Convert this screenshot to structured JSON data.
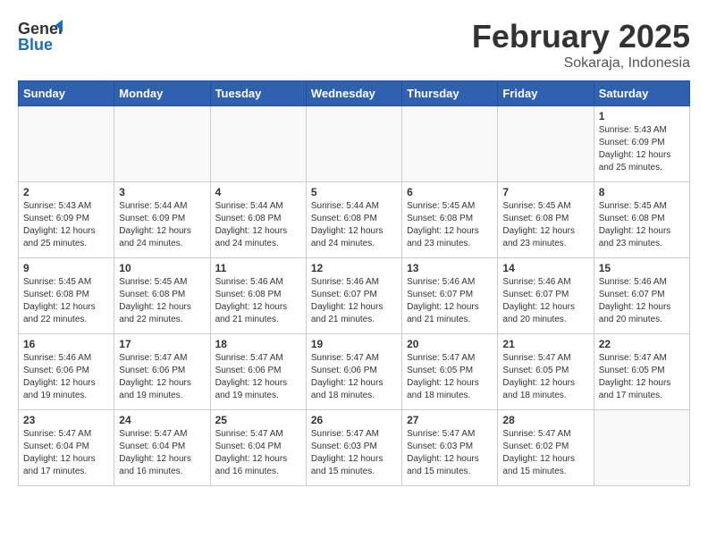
{
  "header": {
    "logo_general": "General",
    "logo_blue": "Blue",
    "month_title": "February 2025",
    "location": "Sokaraja, Indonesia"
  },
  "weekdays": [
    "Sunday",
    "Monday",
    "Tuesday",
    "Wednesday",
    "Thursday",
    "Friday",
    "Saturday"
  ],
  "weeks": [
    [
      {
        "day": "",
        "info": ""
      },
      {
        "day": "",
        "info": ""
      },
      {
        "day": "",
        "info": ""
      },
      {
        "day": "",
        "info": ""
      },
      {
        "day": "",
        "info": ""
      },
      {
        "day": "",
        "info": ""
      },
      {
        "day": "1",
        "info": "Sunrise: 5:43 AM\nSunset: 6:09 PM\nDaylight: 12 hours\nand 25 minutes."
      }
    ],
    [
      {
        "day": "2",
        "info": "Sunrise: 5:43 AM\nSunset: 6:09 PM\nDaylight: 12 hours\nand 25 minutes."
      },
      {
        "day": "3",
        "info": "Sunrise: 5:44 AM\nSunset: 6:09 PM\nDaylight: 12 hours\nand 24 minutes."
      },
      {
        "day": "4",
        "info": "Sunrise: 5:44 AM\nSunset: 6:08 PM\nDaylight: 12 hours\nand 24 minutes."
      },
      {
        "day": "5",
        "info": "Sunrise: 5:44 AM\nSunset: 6:08 PM\nDaylight: 12 hours\nand 24 minutes."
      },
      {
        "day": "6",
        "info": "Sunrise: 5:45 AM\nSunset: 6:08 PM\nDaylight: 12 hours\nand 23 minutes."
      },
      {
        "day": "7",
        "info": "Sunrise: 5:45 AM\nSunset: 6:08 PM\nDaylight: 12 hours\nand 23 minutes."
      },
      {
        "day": "8",
        "info": "Sunrise: 5:45 AM\nSunset: 6:08 PM\nDaylight: 12 hours\nand 23 minutes."
      }
    ],
    [
      {
        "day": "9",
        "info": "Sunrise: 5:45 AM\nSunset: 6:08 PM\nDaylight: 12 hours\nand 22 minutes."
      },
      {
        "day": "10",
        "info": "Sunrise: 5:45 AM\nSunset: 6:08 PM\nDaylight: 12 hours\nand 22 minutes."
      },
      {
        "day": "11",
        "info": "Sunrise: 5:46 AM\nSunset: 6:08 PM\nDaylight: 12 hours\nand 21 minutes."
      },
      {
        "day": "12",
        "info": "Sunrise: 5:46 AM\nSunset: 6:07 PM\nDaylight: 12 hours\nand 21 minutes."
      },
      {
        "day": "13",
        "info": "Sunrise: 5:46 AM\nSunset: 6:07 PM\nDaylight: 12 hours\nand 21 minutes."
      },
      {
        "day": "14",
        "info": "Sunrise: 5:46 AM\nSunset: 6:07 PM\nDaylight: 12 hours\nand 20 minutes."
      },
      {
        "day": "15",
        "info": "Sunrise: 5:46 AM\nSunset: 6:07 PM\nDaylight: 12 hours\nand 20 minutes."
      }
    ],
    [
      {
        "day": "16",
        "info": "Sunrise: 5:46 AM\nSunset: 6:06 PM\nDaylight: 12 hours\nand 19 minutes."
      },
      {
        "day": "17",
        "info": "Sunrise: 5:47 AM\nSunset: 6:06 PM\nDaylight: 12 hours\nand 19 minutes."
      },
      {
        "day": "18",
        "info": "Sunrise: 5:47 AM\nSunset: 6:06 PM\nDaylight: 12 hours\nand 19 minutes."
      },
      {
        "day": "19",
        "info": "Sunrise: 5:47 AM\nSunset: 6:06 PM\nDaylight: 12 hours\nand 18 minutes."
      },
      {
        "day": "20",
        "info": "Sunrise: 5:47 AM\nSunset: 6:05 PM\nDaylight: 12 hours\nand 18 minutes."
      },
      {
        "day": "21",
        "info": "Sunrise: 5:47 AM\nSunset: 6:05 PM\nDaylight: 12 hours\nand 18 minutes."
      },
      {
        "day": "22",
        "info": "Sunrise: 5:47 AM\nSunset: 6:05 PM\nDaylight: 12 hours\nand 17 minutes."
      }
    ],
    [
      {
        "day": "23",
        "info": "Sunrise: 5:47 AM\nSunset: 6:04 PM\nDaylight: 12 hours\nand 17 minutes."
      },
      {
        "day": "24",
        "info": "Sunrise: 5:47 AM\nSunset: 6:04 PM\nDaylight: 12 hours\nand 16 minutes."
      },
      {
        "day": "25",
        "info": "Sunrise: 5:47 AM\nSunset: 6:04 PM\nDaylight: 12 hours\nand 16 minutes."
      },
      {
        "day": "26",
        "info": "Sunrise: 5:47 AM\nSunset: 6:03 PM\nDaylight: 12 hours\nand 15 minutes."
      },
      {
        "day": "27",
        "info": "Sunrise: 5:47 AM\nSunset: 6:03 PM\nDaylight: 12 hours\nand 15 minutes."
      },
      {
        "day": "28",
        "info": "Sunrise: 5:47 AM\nSunset: 6:02 PM\nDaylight: 12 hours\nand 15 minutes."
      },
      {
        "day": "",
        "info": ""
      }
    ]
  ]
}
